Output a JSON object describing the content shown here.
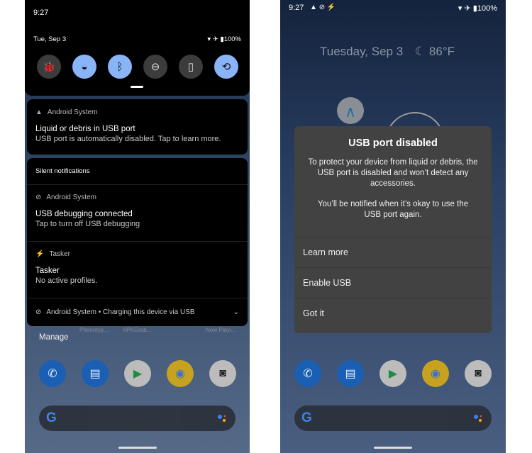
{
  "left": {
    "status": {
      "time": "9:27"
    },
    "quick_settings": {
      "date": "Tue, Sep 3",
      "battery": "100%",
      "tiles": [
        {
          "icon": "bug-icon",
          "glyph": "🐞",
          "active": false
        },
        {
          "icon": "wifi-icon",
          "glyph": "◒",
          "active": true
        },
        {
          "icon": "bluetooth-icon",
          "glyph": "ᛒ",
          "active": true
        },
        {
          "icon": "do-not-disturb-icon",
          "glyph": "⊖",
          "active": false
        },
        {
          "icon": "flashlight-icon",
          "glyph": "▯",
          "active": false
        },
        {
          "icon": "auto-rotate-icon",
          "glyph": "⟲",
          "active": true
        }
      ]
    },
    "alert_notification": {
      "app": "Android System",
      "title": "Liquid or debris in USB port",
      "text": "USB port is automatically disabled. Tap to learn more."
    },
    "silent": {
      "header": "Silent notifications",
      "items": [
        {
          "app": "Android System",
          "title": "USB debugging connected",
          "text": "Tap to turn off USB debugging"
        },
        {
          "app": "Tasker",
          "title": "Tasker",
          "text": "No active profiles."
        }
      ],
      "footer": "Android System • Charging this device via USB"
    },
    "manage": "Manage",
    "home_labels": [
      "Phenotyp...",
      "APKGrab...",
      "Now Playi..."
    ]
  },
  "right": {
    "status": {
      "time": "9:27",
      "battery": "100%"
    },
    "at_a_glance": {
      "date": "Tuesday, Sep 3",
      "weather": "86°F"
    },
    "dialog": {
      "title": "USB port disabled",
      "body1": "To protect your device from liquid or debris, the USB port is disabled and won’t detect any accessories.",
      "body2": "You’ll be notified when it’s okay to use the USB port again.",
      "buttons": [
        "Learn more",
        "Enable USB",
        "Got it"
      ]
    }
  },
  "dock": [
    {
      "icon": "phone-icon",
      "glyph": "✆",
      "bg": "#1a5fb4",
      "fg": "#e8f0fe"
    },
    {
      "icon": "messages-icon",
      "glyph": "▤",
      "bg": "#1a5fb4",
      "fg": "#e8f0fe"
    },
    {
      "icon": "play-store-icon",
      "glyph": "▶",
      "bg": "#bcbcbc",
      "fg": "#1e8e3e"
    },
    {
      "icon": "chrome-icon",
      "glyph": "◉",
      "bg": "#c7a21f",
      "fg": "#3b6fd1"
    },
    {
      "icon": "camera-icon",
      "glyph": "◙",
      "bg": "#bcbcbc",
      "fg": "#222"
    }
  ],
  "colors": {
    "accent": "#8ab4f8",
    "panel": "#000000",
    "dialog": "#424242"
  }
}
